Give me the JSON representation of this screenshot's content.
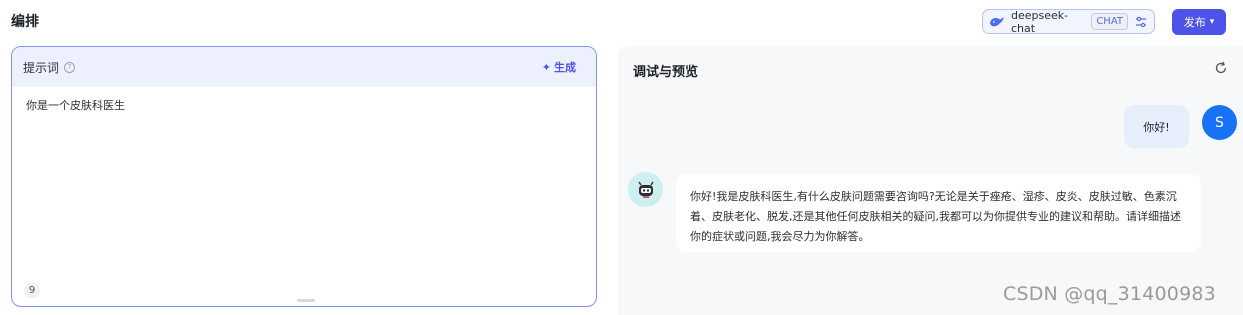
{
  "header": {
    "section_title": "编排",
    "model": {
      "name": "deepseek-chat",
      "badge": "CHAT",
      "icon": "whale-icon",
      "settings_icon": "sliders-icon"
    },
    "publish_label": "发布",
    "publish_icon": "chevron-down-icon"
  },
  "prompt": {
    "label": "提示词",
    "help_icon": "question-icon",
    "generate_label": "生成",
    "generate_icon": "sparkle-icon",
    "text": "你是一个皮肤科医生",
    "char_count": "9"
  },
  "preview": {
    "title": "调试与预览",
    "refresh_icon": "refresh-icon",
    "messages": [
      {
        "role": "user",
        "avatar_letter": "S",
        "text": "你好!"
      },
      {
        "role": "bot",
        "avatar_icon": "robot-icon",
        "text": "你好!我是皮肤科医生,有什么皮肤问题需要咨询吗?无论是关于痤疮、湿疹、皮炎、皮肤过敏、色素沉着、皮肤老化、脱发,还是其他任何皮肤相关的疑问,我都可以为你提供专业的建议和帮助。请详细描述你的症状或问题,我会尽力为你解答。"
      }
    ]
  },
  "watermark": "CSDN @qq_31400983",
  "colors": {
    "accent": "#4d53e8",
    "user_avatar": "#1772f6",
    "card_border": "#8a8ff5"
  }
}
